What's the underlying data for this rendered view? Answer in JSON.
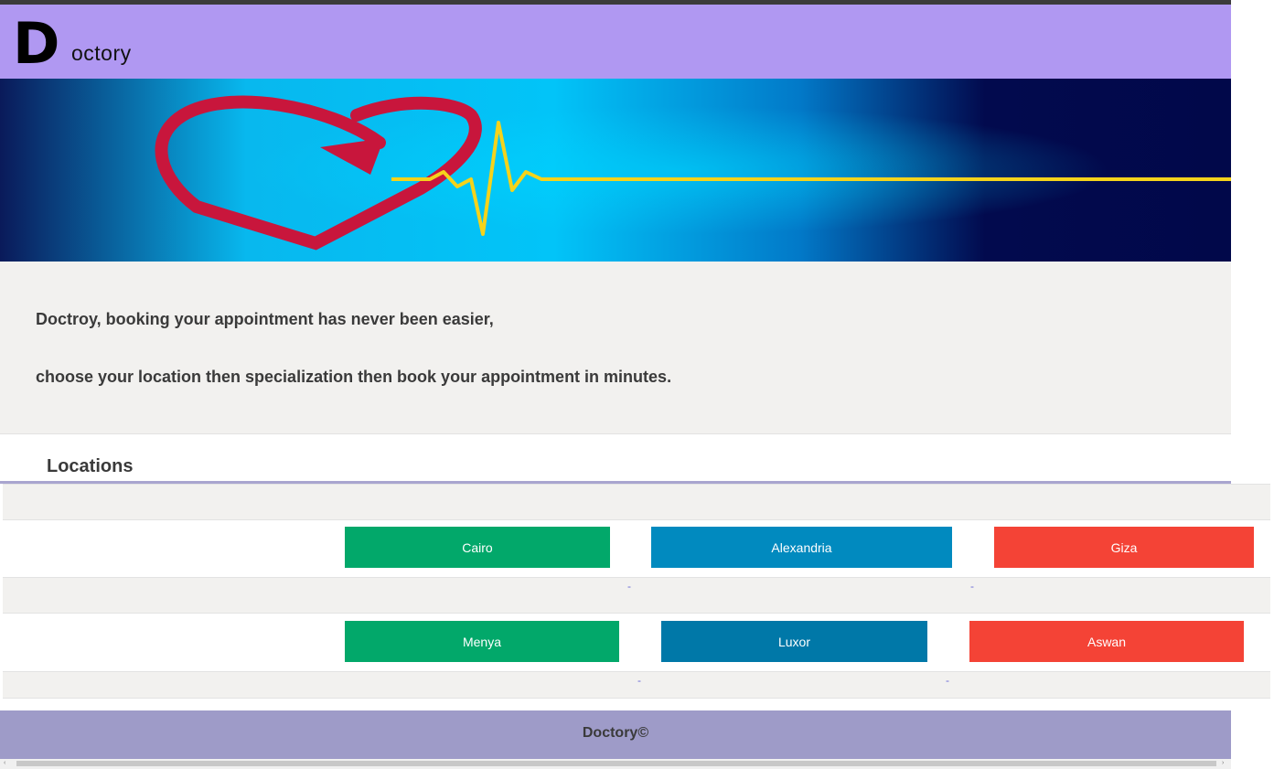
{
  "header": {
    "logo_initial": "D",
    "logo_rest": "octory",
    "bg_color": "#b098f2"
  },
  "banner": {
    "description_icon": "heart-pulse-banner"
  },
  "intro": {
    "line1": "Doctroy, booking your appointment has never been easier,",
    "line2": "choose your location then specialization then book your appointment in minutes."
  },
  "locations": {
    "title": "Locations",
    "row1": [
      {
        "label": "Cairo",
        "color": "#02a86a"
      },
      {
        "label": "Alexandria",
        "color": "#018abf"
      },
      {
        "label": "Giza",
        "color": "#f44336"
      }
    ],
    "row1_separators": [
      "-",
      "-"
    ],
    "row2": [
      {
        "label": "Menya",
        "color": "#02a86a"
      },
      {
        "label": "Luxor",
        "color": "#0078a8"
      },
      {
        "label": "Aswan",
        "color": "#f44336"
      }
    ],
    "row2_separators": [
      "-",
      "-"
    ]
  },
  "footer": {
    "text": "Doctory©",
    "bg_color": "#9e9bc8"
  },
  "scrollbar": {
    "left_arrow": "‹",
    "right_arrow": "›"
  }
}
